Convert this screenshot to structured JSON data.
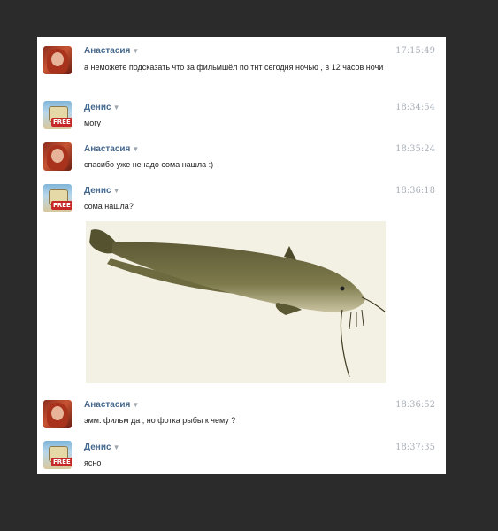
{
  "messages": [
    {
      "author": "Анастасия",
      "time": "17:15:49",
      "text": "а неможете подсказать что за фильмшёл по тнт сегодня ночью , в 12 часов ночи"
    },
    {
      "author": "Денис",
      "time": "18:34:54",
      "text": "могу"
    },
    {
      "author": "Анастасия",
      "time": "18:35:24",
      "text": "спасибо уже ненадо сома нашла :)"
    },
    {
      "author": "Денис",
      "time": "18:36:18",
      "text": "сома нашла?"
    },
    {
      "author": "Анастасия",
      "time": "18:36:52",
      "text": "эмм. фильм да , но фотка рыбы к чему ?"
    },
    {
      "author": "Денис",
      "time": "18:37:35",
      "text": "ясно"
    }
  ],
  "attachment": {
    "description_icon": "catfish-photo"
  },
  "avatars": {
    "denis_badge": "FREE"
  },
  "icons": {
    "name_menu": "caret-down-icon"
  }
}
